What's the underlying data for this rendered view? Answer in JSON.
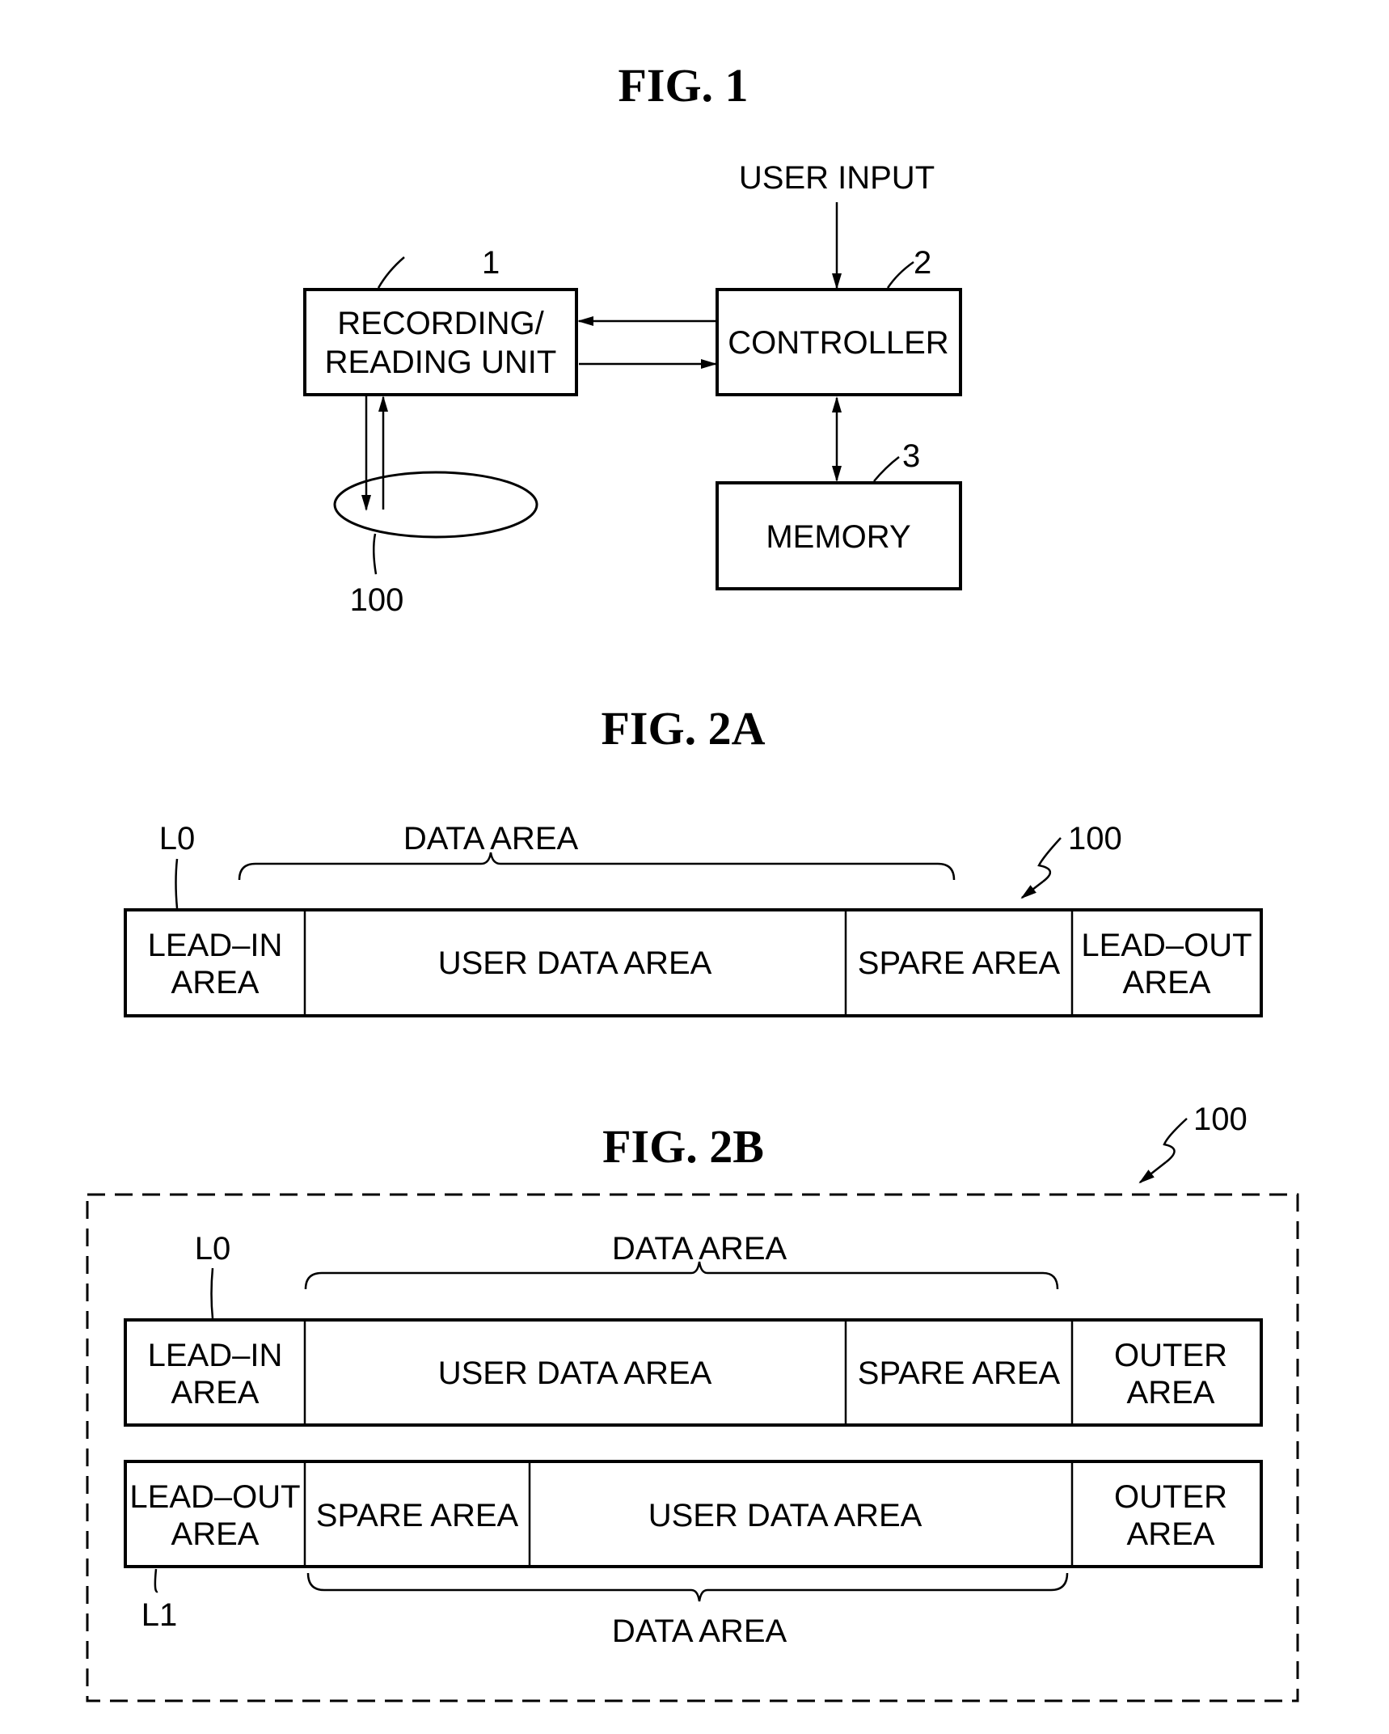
{
  "fig1": {
    "title": "FIG.  1",
    "user_input": "USER INPUT",
    "recording_unit": {
      "line1": "RECORDING/",
      "line2": "READING UNIT",
      "ref": "1"
    },
    "controller": {
      "label": "CONTROLLER",
      "ref": "2"
    },
    "memory": {
      "label": "MEMORY",
      "ref": "3"
    },
    "disc": {
      "ref": "100"
    }
  },
  "fig2a": {
    "title": "FIG.  2A",
    "layer_label": "L0",
    "ref": "100",
    "data_area_label": "DATA AREA",
    "segments": [
      {
        "line1": "LEAD–IN",
        "line2": "AREA"
      },
      {
        "line1": "USER DATA AREA",
        "line2": ""
      },
      {
        "line1": "SPARE AREA",
        "line2": ""
      },
      {
        "line1": "LEAD–OUT",
        "line2": "AREA"
      }
    ]
  },
  "fig2b": {
    "title": "FIG.  2B",
    "ref": "100",
    "l0": {
      "layer_label": "L0",
      "data_area_label": "DATA AREA",
      "segments": [
        {
          "line1": "LEAD–IN",
          "line2": "AREA"
        },
        {
          "line1": "USER DATA AREA",
          "line2": ""
        },
        {
          "line1": "SPARE AREA",
          "line2": ""
        },
        {
          "line1": "OUTER",
          "line2": "AREA"
        }
      ]
    },
    "l1": {
      "layer_label": "L1",
      "data_area_label": "DATA AREA",
      "segments": [
        {
          "line1": "LEAD–OUT",
          "line2": "AREA"
        },
        {
          "line1": "SPARE AREA",
          "line2": ""
        },
        {
          "line1": "USER DATA AREA",
          "line2": ""
        },
        {
          "line1": "OUTER",
          "line2": "AREA"
        }
      ]
    }
  }
}
